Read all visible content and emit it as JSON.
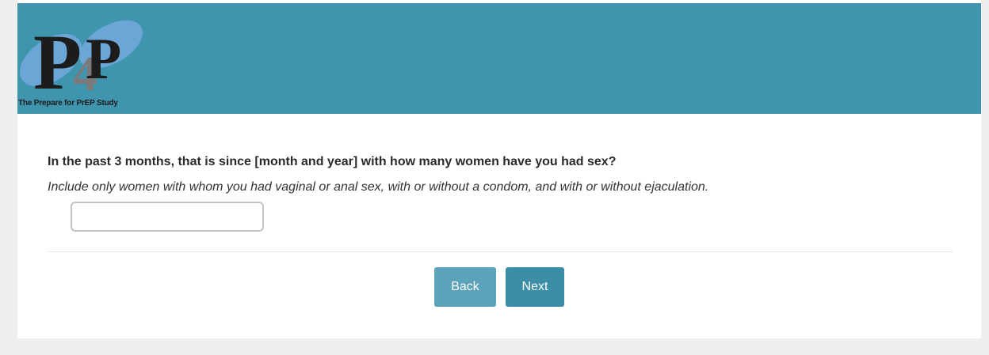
{
  "header": {
    "logo_caption": "The Prepare for PrEP Study",
    "logo_letters": [
      "P",
      "4",
      "P"
    ],
    "background_color": "#4095ae"
  },
  "question": {
    "text": "In the past 3 months, that is since [month and year] with how many women have you had sex?",
    "instruction": "Include only women with whom you had vaginal or anal sex, with or without a condom, and with or without ejaculation.",
    "answer_value": ""
  },
  "navigation": {
    "back_label": "Back",
    "next_label": "Next",
    "back_color": "#5aa3ba",
    "next_color": "#3c8da8"
  }
}
